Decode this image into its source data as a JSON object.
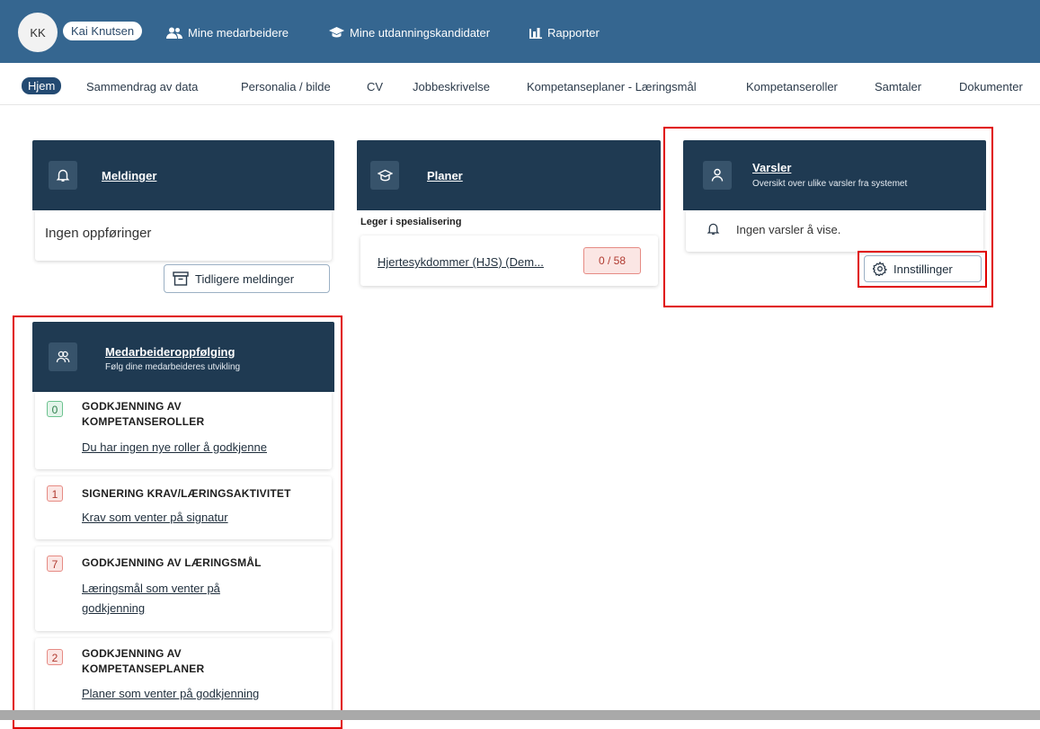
{
  "topbar": {
    "initials": "KK",
    "user_name": "Kai Knutsen",
    "nav": [
      {
        "label": "Mine medarbeidere",
        "icon": "users-icon"
      },
      {
        "label": "Mine utdanningskandidater",
        "icon": "graduation-cap-icon"
      },
      {
        "label": "Rapporter",
        "icon": "bar-chart-icon"
      }
    ]
  },
  "tabs": [
    "Hjem",
    "Sammendrag av data",
    "Personalia / bilde",
    "CV",
    "Jobbeskrivelse",
    "Kompetanseplaner - Læringsmål",
    "Kompetanseroller",
    "Samtaler",
    "Dokumenter"
  ],
  "meldinger": {
    "title": "Meldinger",
    "empty_text": "Ingen oppføringer",
    "button_label": "Tidligere meldinger"
  },
  "planer": {
    "title": "Planer",
    "section_label": "Leger i spesialisering",
    "plan_link": "Hjertesykdommer (HJS) (Dem...",
    "plan_progress": "0 / 58"
  },
  "varsler": {
    "title": "Varsler",
    "subtitle": "Oversikt over ulike varsler fra systemet",
    "empty_text": "Ingen varsler å vise.",
    "button_label": "Innstillinger"
  },
  "medarbeider": {
    "title": "Medarbeideroppfølging",
    "subtitle": "Følg dine medarbeideres utvikling",
    "items": [
      {
        "count": "0",
        "title": "GODKJENNING AV KOMPETANSEROLLER",
        "link": "Du har ingen nye roller å godkjenne",
        "status": "green"
      },
      {
        "count": "1",
        "title": "SIGNERING KRAV/LÆRINGSAKTIVITET",
        "link": "Krav som venter på signatur",
        "status": "red"
      },
      {
        "count": "7",
        "title": "GODKJENNING AV LÆRINGSMÅL",
        "link": "Læringsmål som venter på godkjenning",
        "status": "red"
      },
      {
        "count": "2",
        "title": "GODKJENNING AV KOMPETANSEPLANER",
        "link": "Planer som venter på godkjenning",
        "status": "red"
      }
    ]
  },
  "colors": {
    "topbar": "#356690",
    "card_header": "#1f3a52",
    "highlight_border": "#e00000"
  }
}
